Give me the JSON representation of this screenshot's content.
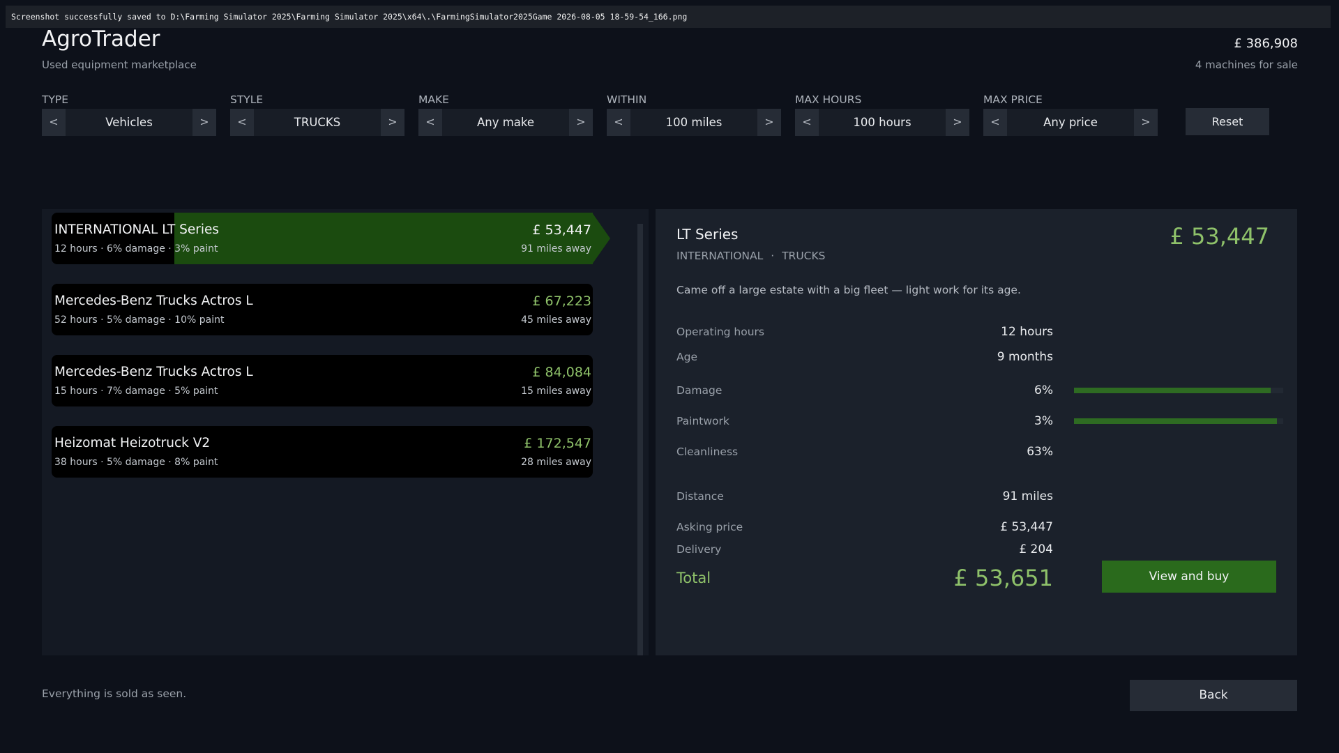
{
  "notification": "Screenshot successfully saved to D:\\Farming Simulator 2025\\Farming Simulator 2025\\x64\\.\\FarmingSimulator2025Game 2026-08-05 18-59-54_166.png",
  "header": {
    "title": "AgroTrader",
    "subtitle": "Used equipment marketplace",
    "balance": "£ 386,908",
    "machines_count": "4 machines for sale"
  },
  "filters": {
    "arrow_prev": "<",
    "arrow_next": ">",
    "items": [
      {
        "label": "TYPE",
        "value": "Vehicles"
      },
      {
        "label": "STYLE",
        "value": "TRUCKS"
      },
      {
        "label": "MAKE",
        "value": "Any make"
      },
      {
        "label": "WITHIN",
        "value": "100 miles"
      },
      {
        "label": "MAX HOURS",
        "value": "100 hours"
      },
      {
        "label": "MAX PRICE",
        "value": "Any price"
      }
    ],
    "reset_label": "Reset"
  },
  "listings": [
    {
      "name": "INTERNATIONAL LT Series",
      "specs": "12 hours · 6% damage · 3% paint",
      "price": "£ 53,447",
      "distance": "91 miles away",
      "selected": true
    },
    {
      "name": "Mercedes-Benz Trucks Actros L",
      "specs": "52 hours · 5% damage · 10% paint",
      "price": "£ 67,223",
      "distance": "45 miles away"
    },
    {
      "name": "Mercedes-Benz Trucks Actros L",
      "specs": "15 hours · 7% damage · 5% paint",
      "price": "£ 84,084",
      "distance": "15 miles away"
    },
    {
      "name": "Heizomat Heizotruck V2",
      "specs": "38 hours · 5% damage · 8% paint",
      "price": "£ 172,547",
      "distance": "28 miles away"
    }
  ],
  "detail": {
    "title": "LT Series",
    "make": "INTERNATIONAL",
    "separator": "·",
    "category": "TRUCKS",
    "price": "£ 53,447",
    "description": "Came off a large estate with a big fleet — light work for its age.",
    "stats": [
      {
        "label": "Operating hours",
        "value": "12 hours"
      },
      {
        "label": "Age",
        "value": "9 months"
      },
      {
        "label": "Damage",
        "value": "6%",
        "bar_fraction": 0.94
      },
      {
        "label": "Paintwork",
        "value": "3%",
        "bar_fraction": 0.97
      },
      {
        "label": "Cleanliness",
        "value": "63%"
      },
      {
        "label": "Distance",
        "value": "91 miles"
      },
      {
        "label": "Asking price",
        "value": "£ 53,447"
      },
      {
        "label": "Delivery",
        "value": "£ 204"
      }
    ],
    "total_label": "Total",
    "total_value": "£ 53,651",
    "buy_label": "View and buy"
  },
  "footer": {
    "disclaimer": "Everything is sold as seen.",
    "back_label": "Back"
  },
  "colors": {
    "accent_green": "#8fc26a",
    "selected_row": "#1b4b0f",
    "buy_button": "#2a6a1c",
    "bar_fill": "#2e6b22"
  }
}
